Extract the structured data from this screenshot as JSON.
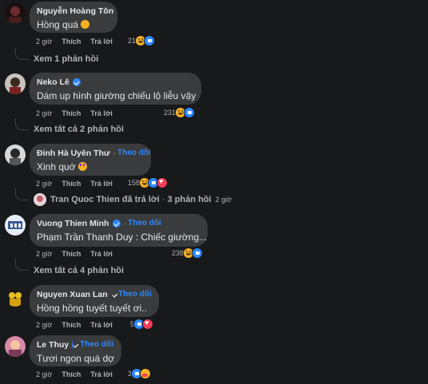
{
  "actions": {
    "time": "2 giờ",
    "like": "Thích",
    "reply": "Trả lời"
  },
  "comments": [
    {
      "name": "Nguyễn Hoàng Tôn",
      "text": "Hồng quá",
      "count": "21",
      "more": "Xem 1 phản hồi"
    },
    {
      "name": "Neko Lê",
      "text": "Dám up hình giường chiếu lộ liễu vậy",
      "count": "231",
      "more": "Xem tất cả 2 phản hồi"
    },
    {
      "name": "Đinh Hà Uyên Thư",
      "follow": "Theo dõi",
      "text": "Xinh quớ",
      "count": "158",
      "preview": {
        "name": "Tran Quoc Thien",
        "action": "đã trả lời",
        "replies": "3 phản hồi",
        "time": "2 giờ"
      }
    },
    {
      "name": "Vuong Thien Minh",
      "follow": "Theo dõi",
      "text": "Phạm Trần Thanh Duy : Chiếc giường...",
      "count": "238",
      "more": "Xem tất cả 4 phản hồi"
    },
    {
      "name": "Nguyen Xuan Lan",
      "follow": "Theo dõi",
      "text": "Hồng hồng tuyết tuyết ơi..",
      "count": "5"
    },
    {
      "name": "Le Thuy",
      "follow": "Theo dõi",
      "text": "Tươi ngon quá dợ",
      "count": "3"
    }
  ],
  "colors": {
    "background": "#18191a",
    "bubble": "#3a3b3c",
    "accent": "#2d88ff",
    "muted": "#b0b3b8"
  }
}
